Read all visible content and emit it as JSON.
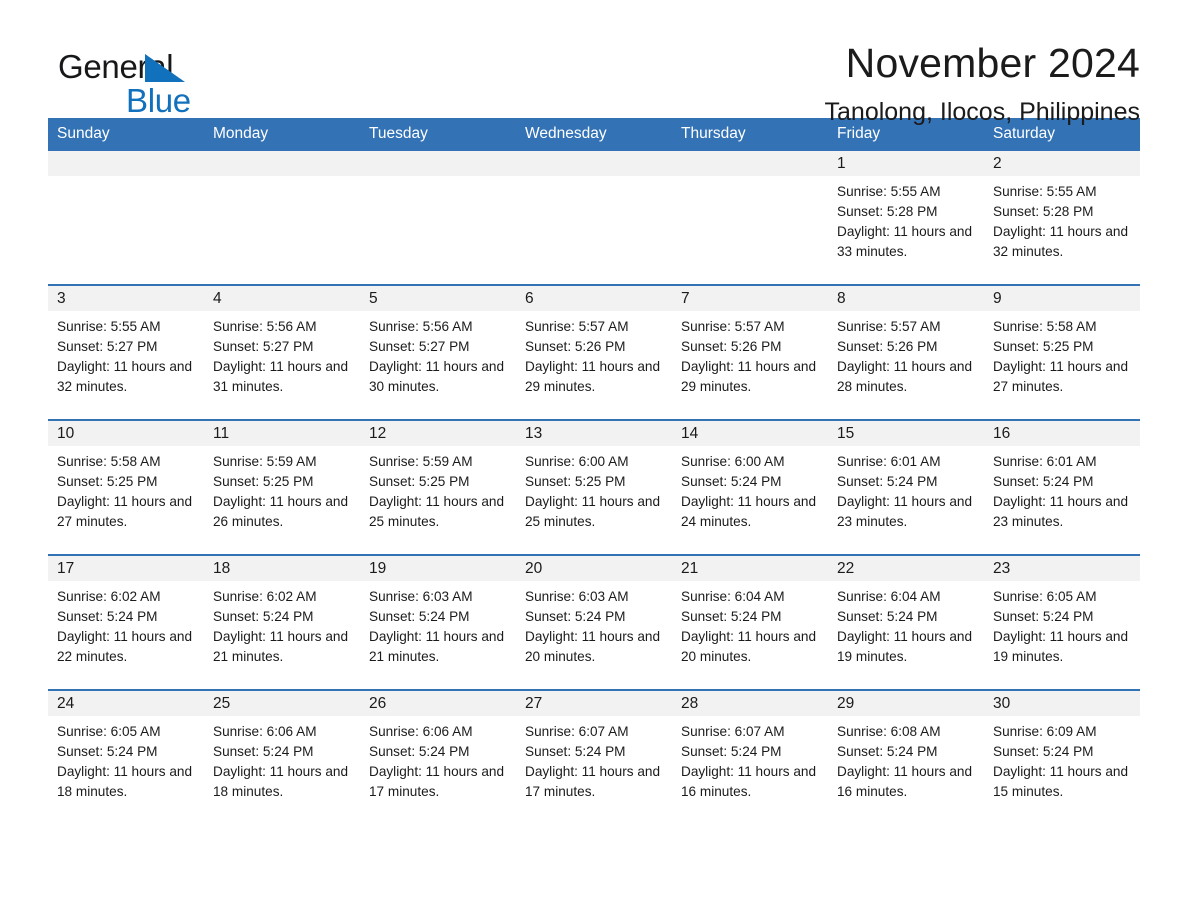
{
  "brand": {
    "name_part1": "General",
    "name_part2": "Blue",
    "accent_color": "#1271bd"
  },
  "header": {
    "title": "November 2024",
    "subtitle": "Tanolong, Ilocos, Philippines"
  },
  "theme": {
    "header_row_color": "#3272b5",
    "daynum_band_color": "#f2f2f2",
    "text_color": "#1b1b1b"
  },
  "calendar": {
    "weekday_headers": [
      "Sunday",
      "Monday",
      "Tuesday",
      "Wednesday",
      "Thursday",
      "Friday",
      "Saturday"
    ],
    "weeks": [
      [
        {
          "day": "",
          "sunrise": "",
          "sunset": "",
          "daylight": ""
        },
        {
          "day": "",
          "sunrise": "",
          "sunset": "",
          "daylight": ""
        },
        {
          "day": "",
          "sunrise": "",
          "sunset": "",
          "daylight": ""
        },
        {
          "day": "",
          "sunrise": "",
          "sunset": "",
          "daylight": ""
        },
        {
          "day": "",
          "sunrise": "",
          "sunset": "",
          "daylight": ""
        },
        {
          "day": "1",
          "sunrise": "Sunrise: 5:55 AM",
          "sunset": "Sunset: 5:28 PM",
          "daylight": "Daylight: 11 hours and 33 minutes."
        },
        {
          "day": "2",
          "sunrise": "Sunrise: 5:55 AM",
          "sunset": "Sunset: 5:28 PM",
          "daylight": "Daylight: 11 hours and 32 minutes."
        }
      ],
      [
        {
          "day": "3",
          "sunrise": "Sunrise: 5:55 AM",
          "sunset": "Sunset: 5:27 PM",
          "daylight": "Daylight: 11 hours and 32 minutes."
        },
        {
          "day": "4",
          "sunrise": "Sunrise: 5:56 AM",
          "sunset": "Sunset: 5:27 PM",
          "daylight": "Daylight: 11 hours and 31 minutes."
        },
        {
          "day": "5",
          "sunrise": "Sunrise: 5:56 AM",
          "sunset": "Sunset: 5:27 PM",
          "daylight": "Daylight: 11 hours and 30 minutes."
        },
        {
          "day": "6",
          "sunrise": "Sunrise: 5:57 AM",
          "sunset": "Sunset: 5:26 PM",
          "daylight": "Daylight: 11 hours and 29 minutes."
        },
        {
          "day": "7",
          "sunrise": "Sunrise: 5:57 AM",
          "sunset": "Sunset: 5:26 PM",
          "daylight": "Daylight: 11 hours and 29 minutes."
        },
        {
          "day": "8",
          "sunrise": "Sunrise: 5:57 AM",
          "sunset": "Sunset: 5:26 PM",
          "daylight": "Daylight: 11 hours and 28 minutes."
        },
        {
          "day": "9",
          "sunrise": "Sunrise: 5:58 AM",
          "sunset": "Sunset: 5:25 PM",
          "daylight": "Daylight: 11 hours and 27 minutes."
        }
      ],
      [
        {
          "day": "10",
          "sunrise": "Sunrise: 5:58 AM",
          "sunset": "Sunset: 5:25 PM",
          "daylight": "Daylight: 11 hours and 27 minutes."
        },
        {
          "day": "11",
          "sunrise": "Sunrise: 5:59 AM",
          "sunset": "Sunset: 5:25 PM",
          "daylight": "Daylight: 11 hours and 26 minutes."
        },
        {
          "day": "12",
          "sunrise": "Sunrise: 5:59 AM",
          "sunset": "Sunset: 5:25 PM",
          "daylight": "Daylight: 11 hours and 25 minutes."
        },
        {
          "day": "13",
          "sunrise": "Sunrise: 6:00 AM",
          "sunset": "Sunset: 5:25 PM",
          "daylight": "Daylight: 11 hours and 25 minutes."
        },
        {
          "day": "14",
          "sunrise": "Sunrise: 6:00 AM",
          "sunset": "Sunset: 5:24 PM",
          "daylight": "Daylight: 11 hours and 24 minutes."
        },
        {
          "day": "15",
          "sunrise": "Sunrise: 6:01 AM",
          "sunset": "Sunset: 5:24 PM",
          "daylight": "Daylight: 11 hours and 23 minutes."
        },
        {
          "day": "16",
          "sunrise": "Sunrise: 6:01 AM",
          "sunset": "Sunset: 5:24 PM",
          "daylight": "Daylight: 11 hours and 23 minutes."
        }
      ],
      [
        {
          "day": "17",
          "sunrise": "Sunrise: 6:02 AM",
          "sunset": "Sunset: 5:24 PM",
          "daylight": "Daylight: 11 hours and 22 minutes."
        },
        {
          "day": "18",
          "sunrise": "Sunrise: 6:02 AM",
          "sunset": "Sunset: 5:24 PM",
          "daylight": "Daylight: 11 hours and 21 minutes."
        },
        {
          "day": "19",
          "sunrise": "Sunrise: 6:03 AM",
          "sunset": "Sunset: 5:24 PM",
          "daylight": "Daylight: 11 hours and 21 minutes."
        },
        {
          "day": "20",
          "sunrise": "Sunrise: 6:03 AM",
          "sunset": "Sunset: 5:24 PM",
          "daylight": "Daylight: 11 hours and 20 minutes."
        },
        {
          "day": "21",
          "sunrise": "Sunrise: 6:04 AM",
          "sunset": "Sunset: 5:24 PM",
          "daylight": "Daylight: 11 hours and 20 minutes."
        },
        {
          "day": "22",
          "sunrise": "Sunrise: 6:04 AM",
          "sunset": "Sunset: 5:24 PM",
          "daylight": "Daylight: 11 hours and 19 minutes."
        },
        {
          "day": "23",
          "sunrise": "Sunrise: 6:05 AM",
          "sunset": "Sunset: 5:24 PM",
          "daylight": "Daylight: 11 hours and 19 minutes."
        }
      ],
      [
        {
          "day": "24",
          "sunrise": "Sunrise: 6:05 AM",
          "sunset": "Sunset: 5:24 PM",
          "daylight": "Daylight: 11 hours and 18 minutes."
        },
        {
          "day": "25",
          "sunrise": "Sunrise: 6:06 AM",
          "sunset": "Sunset: 5:24 PM",
          "daylight": "Daylight: 11 hours and 18 minutes."
        },
        {
          "day": "26",
          "sunrise": "Sunrise: 6:06 AM",
          "sunset": "Sunset: 5:24 PM",
          "daylight": "Daylight: 11 hours and 17 minutes."
        },
        {
          "day": "27",
          "sunrise": "Sunrise: 6:07 AM",
          "sunset": "Sunset: 5:24 PM",
          "daylight": "Daylight: 11 hours and 17 minutes."
        },
        {
          "day": "28",
          "sunrise": "Sunrise: 6:07 AM",
          "sunset": "Sunset: 5:24 PM",
          "daylight": "Daylight: 11 hours and 16 minutes."
        },
        {
          "day": "29",
          "sunrise": "Sunrise: 6:08 AM",
          "sunset": "Sunset: 5:24 PM",
          "daylight": "Daylight: 11 hours and 16 minutes."
        },
        {
          "day": "30",
          "sunrise": "Sunrise: 6:09 AM",
          "sunset": "Sunset: 5:24 PM",
          "daylight": "Daylight: 11 hours and 15 minutes."
        }
      ]
    ]
  }
}
